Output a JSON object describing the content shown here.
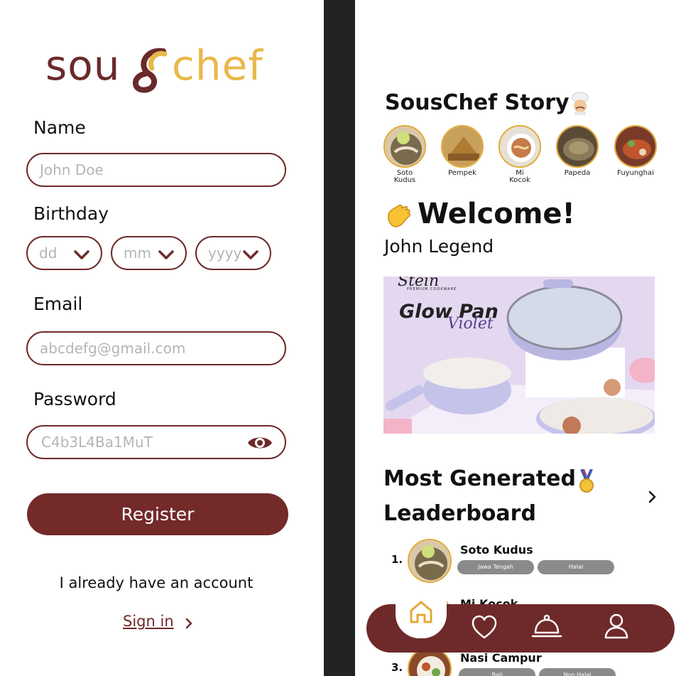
{
  "register": {
    "logo": {
      "part1": "sou",
      "part2": "chef"
    },
    "name": {
      "label": "Name",
      "placeholder": "John Doe"
    },
    "birthday": {
      "label": "Birthday",
      "day": "dd",
      "month": "mm",
      "year": "yyyy"
    },
    "email": {
      "label": "Email",
      "placeholder": "abcdefg@gmail.com"
    },
    "password": {
      "label": "Password",
      "value": "C4b3L4Ba1MuT"
    },
    "register_label": "Register",
    "have_account": "I already have an account",
    "signin_label": "Sign in"
  },
  "home": {
    "story_title": "SousChef Story",
    "stories": [
      {
        "line1": "Soto",
        "line2": "Kudus"
      },
      {
        "line1": "Pempek",
        "line2": ""
      },
      {
        "line1": "Mi",
        "line2": "Kocok"
      },
      {
        "line1": "Papeda",
        "line2": ""
      },
      {
        "line1": "Fuyunghai",
        "line2": ""
      }
    ],
    "welcome": "Welcome!",
    "username": "John Legend",
    "banner": {
      "brand": "Stein",
      "brand_sub": "PREMIUM COOKWARE",
      "product": "Glow Pan",
      "variant": "Violet"
    },
    "leaderboard": {
      "title_line1": "Most Generated",
      "title_line2": "Leaderboard",
      "items": [
        {
          "rank": "1.",
          "name": "Soto Kudus",
          "tags": [
            "Jawa Tengah",
            "Halal"
          ]
        },
        {
          "rank": "",
          "name": "Mi Kocok",
          "tags": []
        },
        {
          "rank": "3.",
          "name": "Nasi Campur",
          "tags": [
            "Bali",
            "Non Halal"
          ]
        }
      ]
    },
    "nav": [
      "home-icon",
      "heart-icon",
      "cloche-icon",
      "profile-icon"
    ]
  },
  "colors": {
    "brand_maroon": "#6e2a2a",
    "brand_gold": "#e8b84a",
    "story_ring": "#e2a936"
  }
}
